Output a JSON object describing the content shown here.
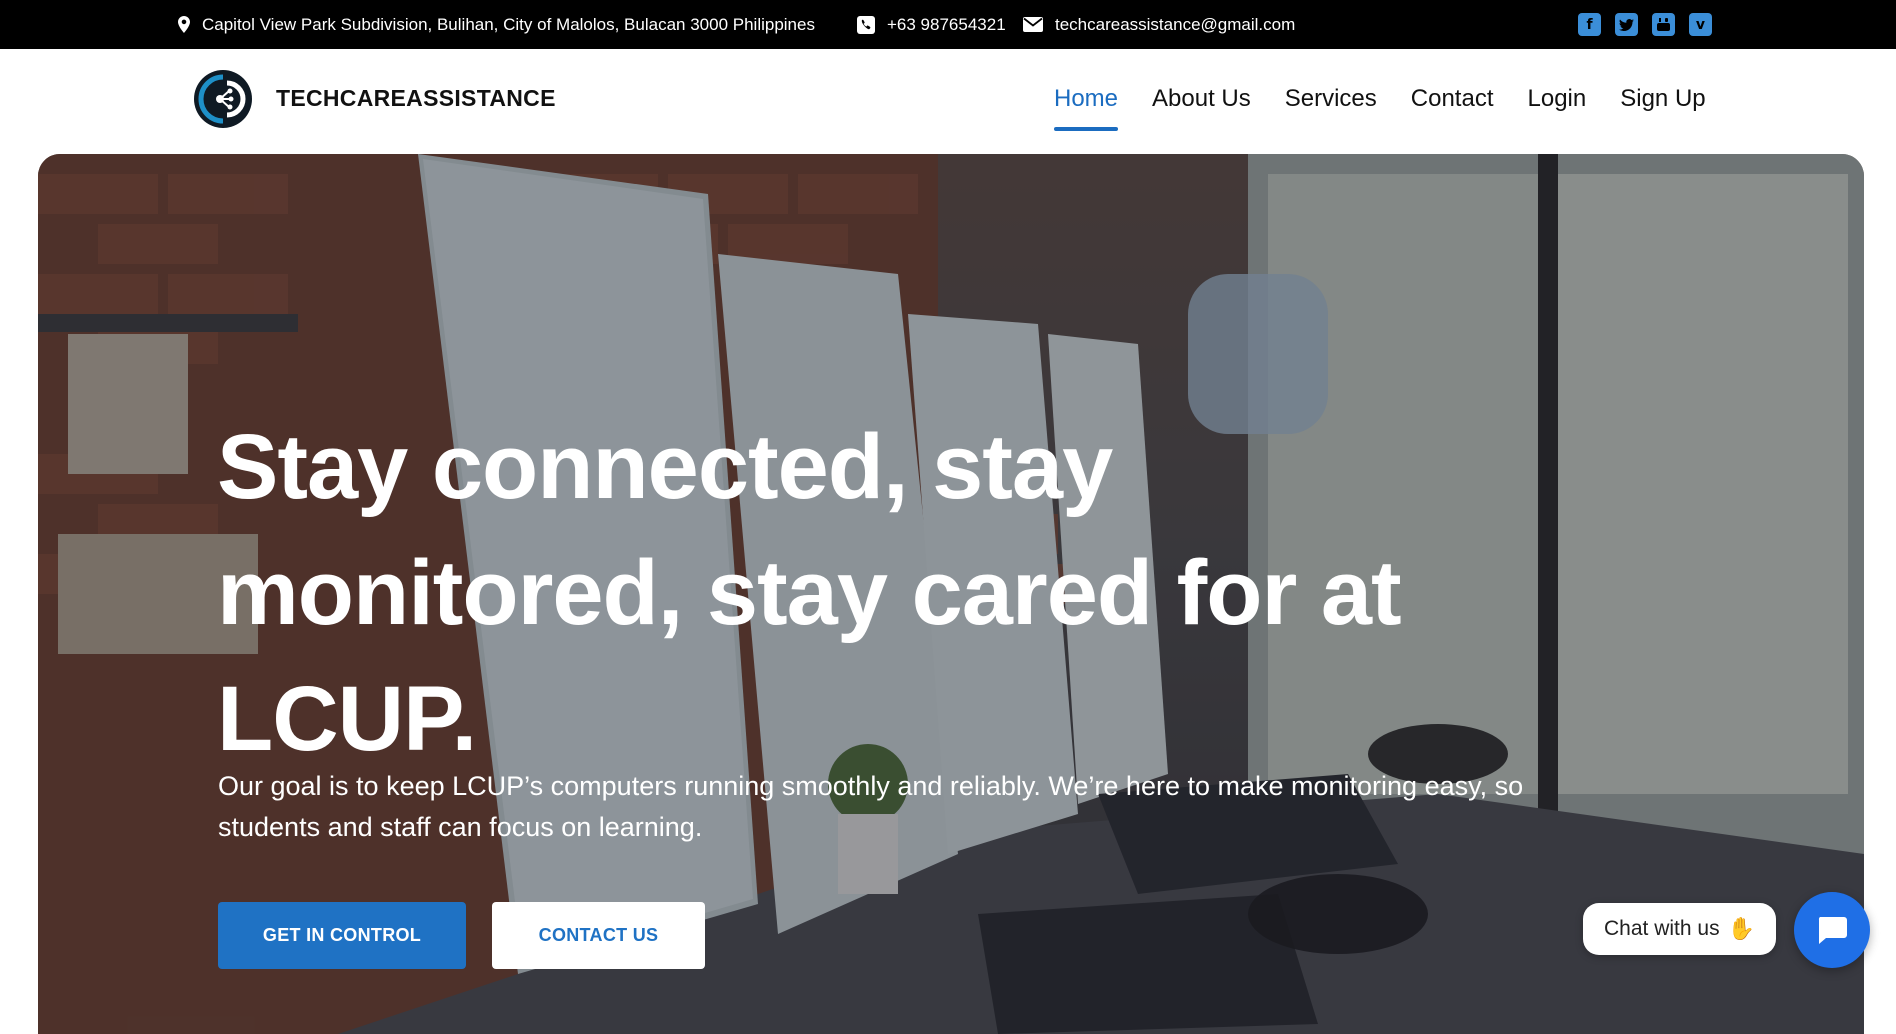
{
  "topbar": {
    "address": "Capitol View Park Subdivision, Bulihan, City of Malolos, Bulacan 3000 Philippines",
    "phone": "+63 987654321",
    "email": "techcareassistance@gmail.com",
    "social": [
      "facebook-icon",
      "twitter-icon",
      "youtube-icon",
      "vimeo-icon"
    ]
  },
  "header": {
    "brand": "TECHCAREASSISTANCE",
    "nav": [
      "Home",
      "About Us",
      "Services",
      "Contact",
      "Login",
      "Sign Up"
    ],
    "active": "Home"
  },
  "hero": {
    "title": "Stay connected, stay monitored, stay cared for at LCUP.",
    "subtitle": "Our goal is to keep LCUP’s computers running smoothly and reliably. We’re here to make monitoring easy, so students and staff can focus on learning.",
    "primary_button": "GET IN CONTROL",
    "secondary_button": "CONTACT US"
  },
  "chat": {
    "label": "Chat with us"
  },
  "colors": {
    "accent": "#1f72c4",
    "chat": "#1f6fe6",
    "topbar_bg": "#000000"
  }
}
